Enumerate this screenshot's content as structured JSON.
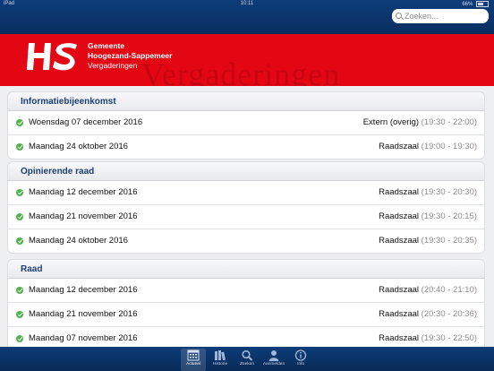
{
  "status": {
    "device": "iPad",
    "time": "10:11",
    "battery": "66%"
  },
  "search": {
    "placeholder": "Zoeken..."
  },
  "header": {
    "org_line1": "Gemeente",
    "org_line2": "Hoogezand-Sappemeer",
    "org_line3": "Vergaderingen",
    "watermark": "Vergaderingen",
    "logo_text": "HS"
  },
  "sections": [
    {
      "title": "Informatiebijeenkomst",
      "rows": [
        {
          "date": "Woensdag 07 december 2016",
          "location": "Extern (overig)",
          "time": "(19:30 - 22:00)"
        },
        {
          "date": "Maandag 24 oktober 2016",
          "location": "Raadszaal",
          "time": "(19:00 - 19:30)"
        }
      ]
    },
    {
      "title": "Opinierende raad",
      "rows": [
        {
          "date": "Maandag 12 december 2016",
          "location": "Raadszaal",
          "time": "(19:30 - 20:30)"
        },
        {
          "date": "Maandag 21 november 2016",
          "location": "Raadszaal",
          "time": "(19:30 - 20:15)"
        },
        {
          "date": "Maandag 24 oktober 2016",
          "location": "Raadszaal",
          "time": "(19:30 - 20:35)"
        }
      ]
    },
    {
      "title": "Raad",
      "rows": [
        {
          "date": "Maandag 12 december 2016",
          "location": "Raadszaal",
          "time": "(20:40 - 21:10)"
        },
        {
          "date": "Maandag 21 november 2016",
          "location": "Raadszaal",
          "time": "(20:30 - 20:36)"
        },
        {
          "date": "Maandag 07 november 2016",
          "location": "Raadszaal",
          "time": "(19:30 - 22:50)"
        }
      ]
    }
  ],
  "tabs": [
    {
      "label": "Actueel",
      "icon": "calendar-icon",
      "active": true
    },
    {
      "label": "Historie",
      "icon": "books-icon",
      "active": false
    },
    {
      "label": "Zoeken",
      "icon": "search-icon",
      "active": false
    },
    {
      "label": "Aanmelden",
      "icon": "person-icon",
      "active": false
    },
    {
      "label": "Info",
      "icon": "info-icon",
      "active": false
    }
  ],
  "colors": {
    "nav": "#0d3c78",
    "header": "#e30613",
    "section_title": "#1a3f73",
    "check": "#4db24a"
  }
}
